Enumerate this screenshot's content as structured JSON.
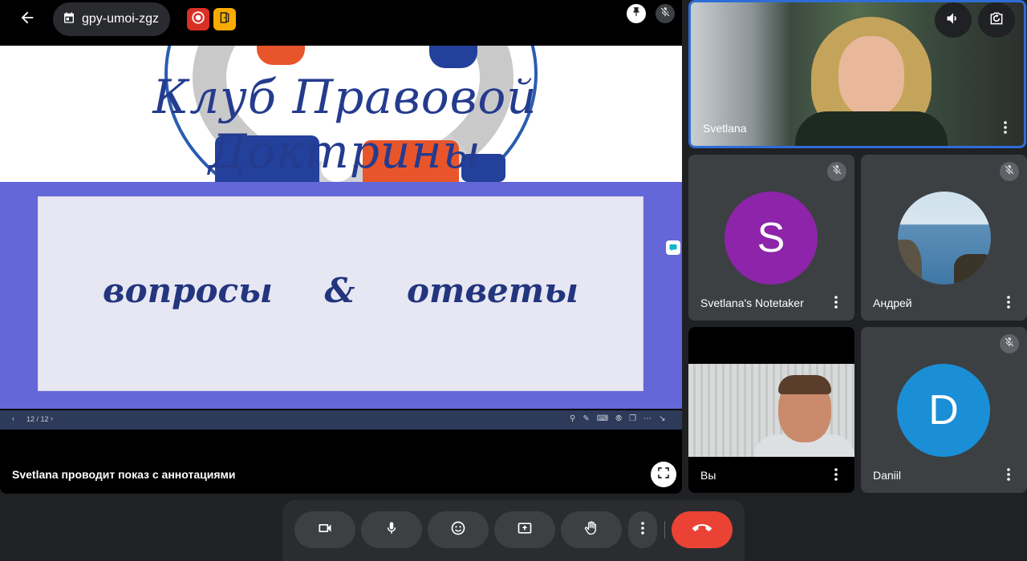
{
  "meeting": {
    "code": "gpy-umoi-zgz"
  },
  "slide": {
    "title": "Клуб Правовой Доктрины",
    "body_text": "вопросы & ответы",
    "page_indicator": "12 / 12"
  },
  "presenter_caption": "Svetlana проводит показ с аннотациями",
  "participants": {
    "main": {
      "name": "Svetlana"
    },
    "notetaker": {
      "name": "Svetlana's Notetaker",
      "initial": "S",
      "color": "#8e24aa"
    },
    "andrey": {
      "name": "Андрей"
    },
    "self": {
      "name": "Вы"
    },
    "daniil": {
      "name": "Daniil",
      "initial": "D",
      "color": "#1a8fd6"
    }
  },
  "colors": {
    "accent_border": "#2f6dd6",
    "end_call": "#ea4335",
    "record_badge": "#d93025",
    "door_badge": "#f9ab00",
    "slide_band": "#6367d8"
  },
  "icons": {
    "back": "arrow-left-icon",
    "calendar": "calendar-icon",
    "record": "record-icon",
    "door": "door-icon",
    "pin": "pin-icon",
    "mic_off": "mic-off-icon",
    "volume": "volume-icon",
    "rotate": "camera-rotate-icon",
    "more": "more-vertical-icon",
    "fullscreen": "fullscreen-icon",
    "camera": "camera-icon",
    "mic": "mic-icon",
    "emoji": "emoji-icon",
    "present": "present-screen-icon",
    "hand": "raise-hand-icon",
    "end_call": "end-call-icon"
  }
}
